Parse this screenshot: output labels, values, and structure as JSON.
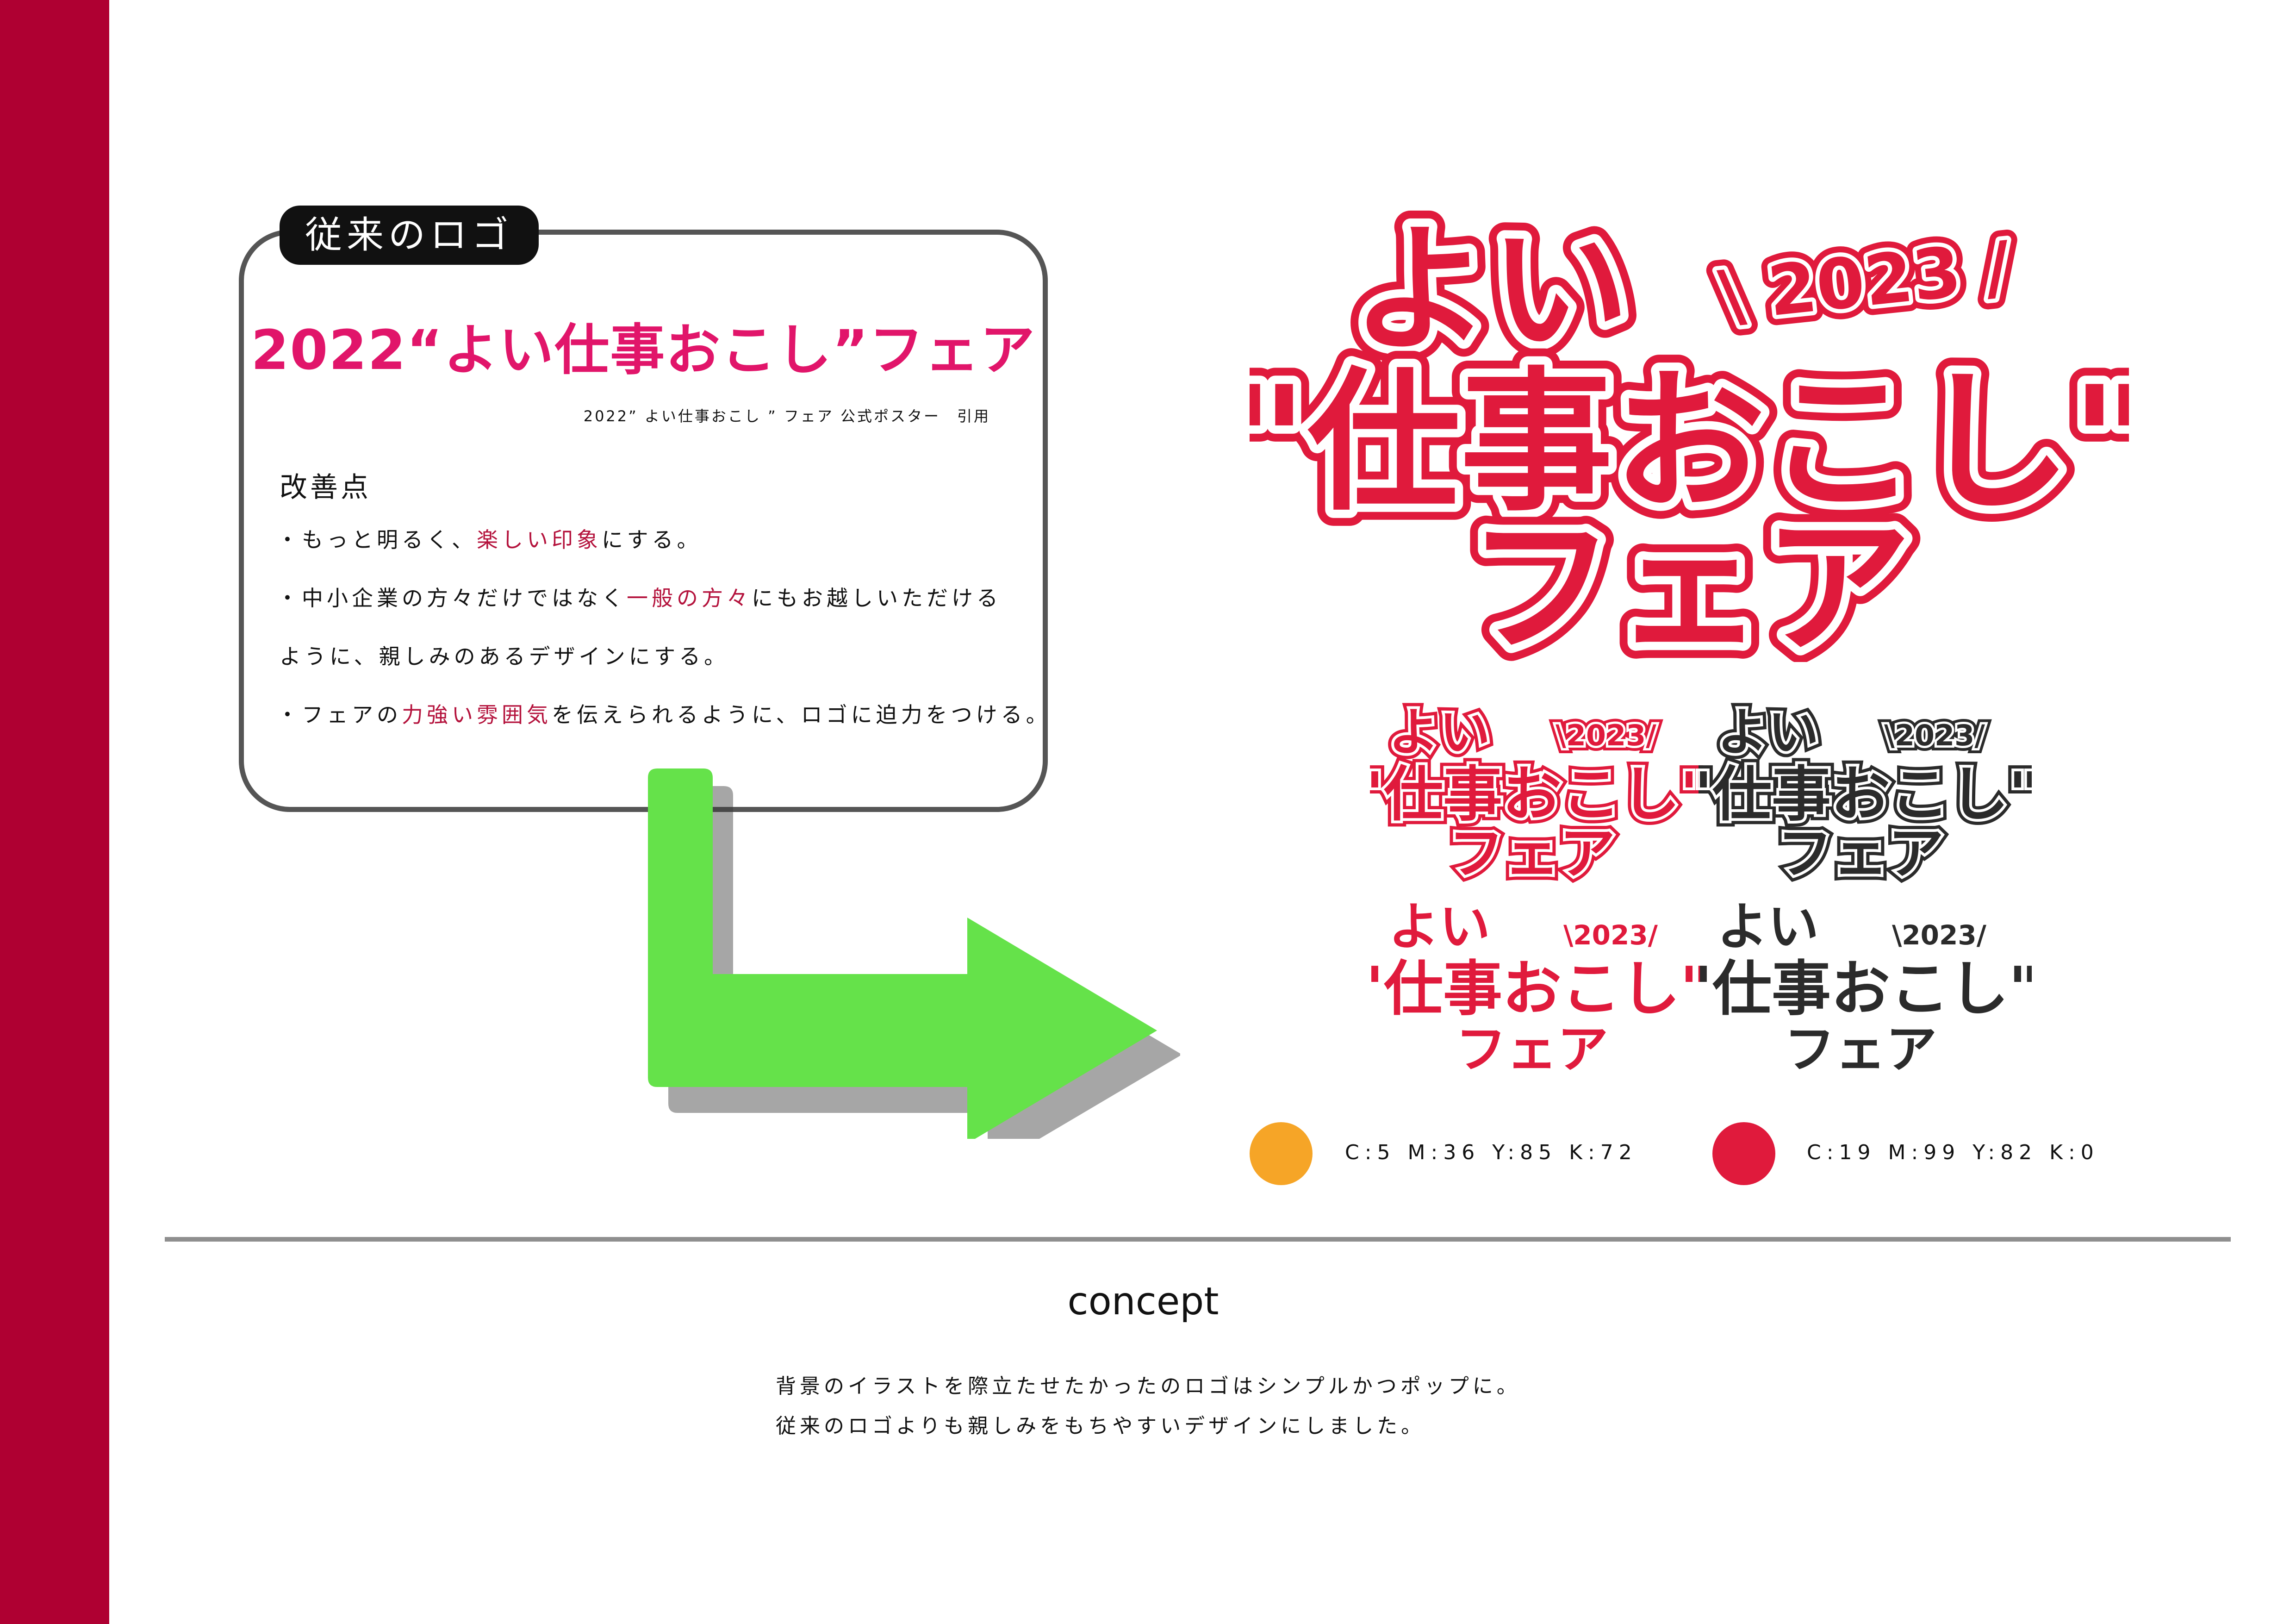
{
  "colors": {
    "sidebar": "#af0032",
    "brand_red": "#e01a3c",
    "orange": "#f6a527",
    "arrow_green": "#65e24a",
    "dark": "#2b2b2b"
  },
  "old_logo": {
    "tag": "従来のロゴ",
    "title": "2022“よい仕事おこし”フェア",
    "caption": "2022” よい仕事おこし ” フェア 公式ポスター　引用"
  },
  "improvements": {
    "heading": "改善点",
    "p1": {
      "a": "・もっと明るく、",
      "hl": "楽しい印象",
      "b": "にする。"
    },
    "p2": {
      "a": "・中小企業の方々だけではなく",
      "hl": "一般の方々",
      "b": "にもお越しいただける"
    },
    "p3": {
      "a": "ように、親しみのあるデザインにする。"
    },
    "p4": {
      "a": "・フェアの",
      "hl": "力強い雰囲気",
      "b": "を伝えられるように、ロゴに迫力をつける。"
    }
  },
  "new_logo": {
    "line1": "よい",
    "line2": "\"仕事おこし\"",
    "line3": "フェア",
    "year": "2023"
  },
  "palette": [
    {
      "color": "#f6a527",
      "text": "C:5  M:36  Y:85  K:72"
    },
    {
      "color": "#e01a3c",
      "text": "C:19  M:99  Y:82  K:0"
    }
  ],
  "concept": {
    "title": "concept",
    "line1": "背景のイラストを際立たせたかったのロゴはシンプルかつポップに。",
    "line2": "従来のロゴよりも親しみをもちやすいデザインにしました。"
  }
}
